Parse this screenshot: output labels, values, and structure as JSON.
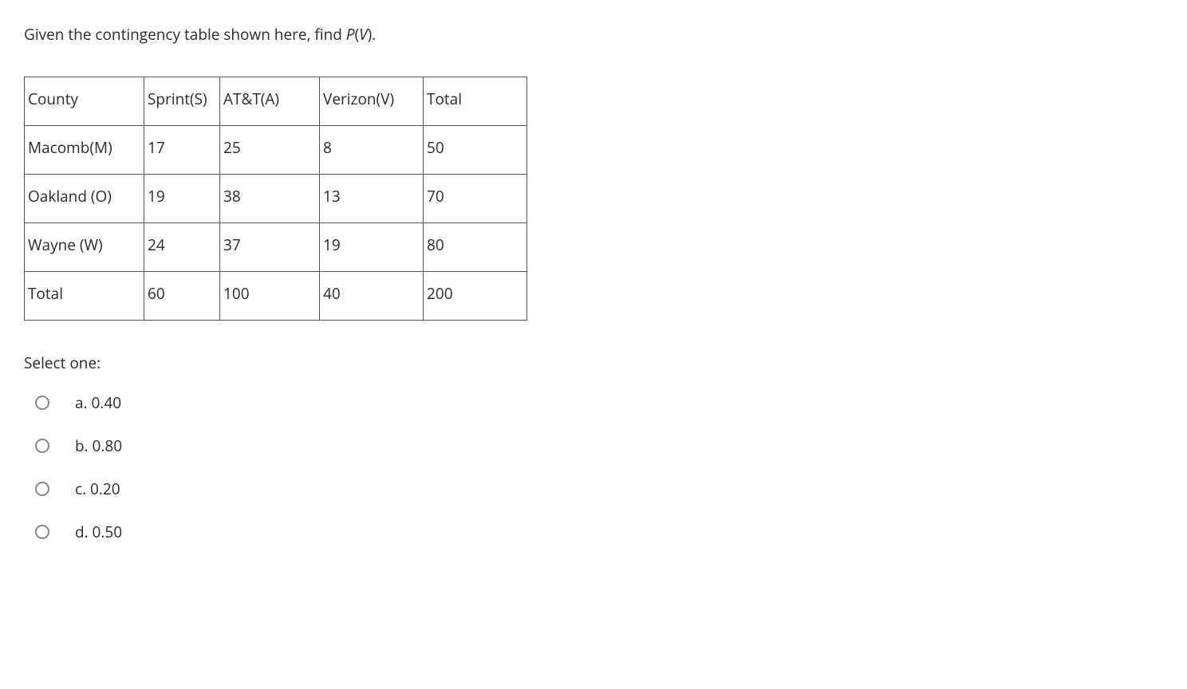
{
  "question": {
    "prefix": "Given the contingency table shown here, find ",
    "formula_p": "P",
    "formula_paren_open": "(",
    "formula_v": "V",
    "formula_paren_close": ").",
    "full": "Given the contingency table shown here, find P(V)."
  },
  "table": {
    "headers": {
      "county": "County",
      "sprint": "Sprint(S)",
      "att": "AT&T(A)",
      "verizon": "Verizon(V)",
      "total": "Total"
    },
    "rows": [
      {
        "county": "Macomb(M)",
        "sprint": "17",
        "att": "25",
        "verizon": "8",
        "total": "50"
      },
      {
        "county": "Oakland (O)",
        "sprint": "19",
        "att": "38",
        "verizon": "13",
        "total": "70"
      },
      {
        "county": "Wayne (W)",
        "sprint": "24",
        "att": "37",
        "verizon": "19",
        "total": "80"
      },
      {
        "county": "Total",
        "sprint": "60",
        "att": "100",
        "verizon": "40",
        "total": "200"
      }
    ]
  },
  "select_label": "Select one:",
  "options": [
    {
      "label": "a. 0.40"
    },
    {
      "label": "b. 0.80"
    },
    {
      "label": "c. 0.20"
    },
    {
      "label": "d. 0.50"
    }
  ]
}
